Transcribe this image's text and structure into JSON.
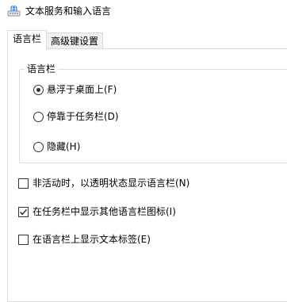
{
  "window": {
    "title": "文本服务和输入语言",
    "icon": "text-services-icon"
  },
  "tabs": [
    {
      "label": "语言栏",
      "active": true
    },
    {
      "label": "高级键设置",
      "active": false
    }
  ],
  "language_bar_group": {
    "legend": "语言栏",
    "options": [
      {
        "label": "悬浮于桌面上(F)",
        "checked": true
      },
      {
        "label": "停靠于任务栏(D)",
        "checked": false
      },
      {
        "label": "隐藏(H)",
        "checked": false
      }
    ]
  },
  "checkboxes": [
    {
      "label": "非活动时，以透明状态显示语言栏(N)",
      "checked": false
    },
    {
      "label": "在任务栏中显示其他语言栏图标(I)",
      "checked": true
    },
    {
      "label": "在语言栏上显示文本标签(E)",
      "checked": false
    }
  ]
}
